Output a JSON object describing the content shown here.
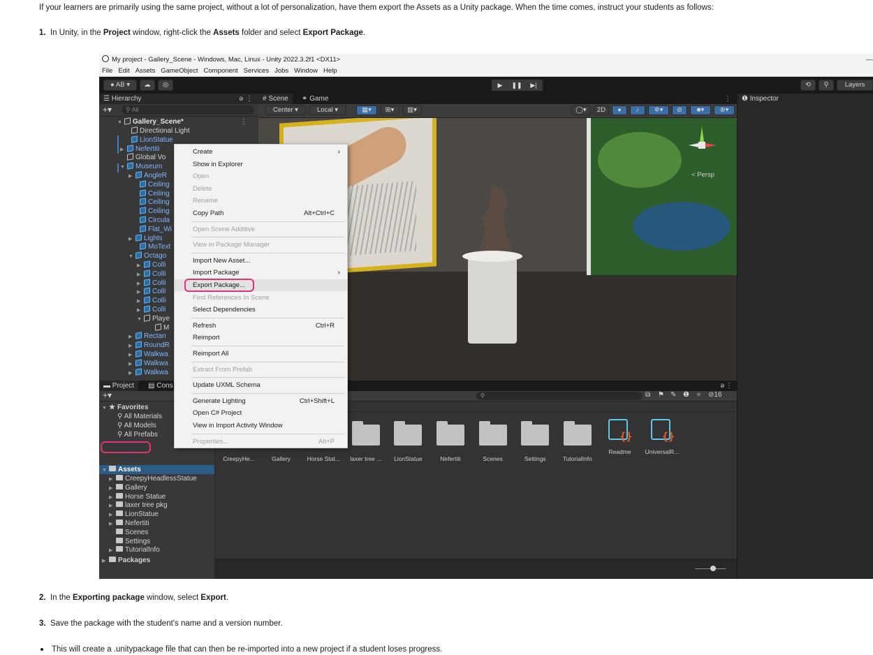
{
  "doc": {
    "intro": "If your learners are primarily using the same project, without a lot of personalization, have them export the Assets as a Unity package. When the time comes, instruct your students as follows:",
    "step1": {
      "num": "1.",
      "p1": "In Unity, in the ",
      "b1": "Project",
      "p2": " window, right-click the ",
      "b2": "Assets",
      "p3": " folder and select ",
      "b3": "Export Package",
      "p4": "."
    },
    "step2": {
      "num": "2.",
      "p1": "In the ",
      "b1": "Exporting package",
      "p2": " window, select ",
      "b2": "Export",
      "p3": "."
    },
    "step3": {
      "num": "3.",
      "text": "Save the package with the student's name and a version number."
    },
    "bullet": "This will create a .unitypackage file that can then be re-imported into a new project if a student loses progress."
  },
  "unity": {
    "title": "My project - Gallery_Scene - Windows, Mac, Linux - Unity 2022.3.2f1 <DX11>",
    "menu": [
      "File",
      "Edit",
      "Assets",
      "GameObject",
      "Component",
      "Services",
      "Jobs",
      "Window",
      "Help"
    ],
    "toolbar": {
      "account": "AB ▾",
      "cloud": "☁",
      "settings": "◎",
      "play": "▶",
      "pause": "❚❚",
      "step": "▶|",
      "history": "⟲",
      "search": "⚲",
      "layers": "Layers"
    },
    "hierarchy": {
      "tab": "☰ Hierarchy",
      "search_placeholder": "All",
      "scene_name": "Gallery_Scene*",
      "items": [
        {
          "label": "Directional Light",
          "blue": false
        },
        {
          "label": "LionStatue",
          "blue": true
        },
        {
          "label": "Nefertiti",
          "blue": true
        },
        {
          "label": "Global Vo",
          "blue": false
        },
        {
          "label": "Museum",
          "blue": true
        },
        {
          "label": "AngleR",
          "blue": true
        },
        {
          "label": "Ceiling",
          "blue": true
        },
        {
          "label": "Ceiling",
          "blue": true
        },
        {
          "label": "Ceiling",
          "blue": true
        },
        {
          "label": "Ceiling",
          "blue": true
        },
        {
          "label": "Circula",
          "blue": true
        },
        {
          "label": "Flat_Wi",
          "blue": true
        },
        {
          "label": "Lights",
          "blue": true
        },
        {
          "label": "MoText",
          "blue": true
        },
        {
          "label": "Octago",
          "blue": true
        },
        {
          "label": "Colli",
          "blue": true
        },
        {
          "label": "Colli",
          "blue": true
        },
        {
          "label": "Colli",
          "blue": true
        },
        {
          "label": "Colli",
          "blue": true
        },
        {
          "label": "Colli",
          "blue": true
        },
        {
          "label": "Colli",
          "blue": true
        },
        {
          "label": "Playe",
          "blue": false
        },
        {
          "label": "M",
          "blue": false
        },
        {
          "label": "Rectan",
          "blue": true
        },
        {
          "label": "RoundR",
          "blue": true
        },
        {
          "label": "Walkwa",
          "blue": true
        },
        {
          "label": "Walkwa",
          "blue": true
        },
        {
          "label": "Walkwa",
          "blue": true
        }
      ]
    },
    "scene": {
      "tab_scene": "# Scene",
      "tab_game": "⚭ Game",
      "pivot": "Center ▾",
      "space": "Local ▾",
      "mode_2d": "2D",
      "persp": "< Persp"
    },
    "inspector": {
      "tab": "❶ Inspector"
    },
    "project": {
      "tab_project": "Project",
      "tab_console": "Cons",
      "hidden_count": "16",
      "favorites": {
        "label": "Favorites",
        "items": [
          "All Materials",
          "All Models",
          "All Prefabs"
        ]
      },
      "assets_label": "Assets",
      "asset_folders": [
        "CreepyHeadlessStatue",
        "Gallery",
        "Horse Statue",
        "laxer tree pkg",
        "LionStatue",
        "Nefertiti",
        "Scenes",
        "Settings",
        "TutorialInfo"
      ],
      "packages_label": "Packages",
      "grid": [
        {
          "label": "CreepyHe...",
          "kind": "folder"
        },
        {
          "label": "Gallery",
          "kind": "folder"
        },
        {
          "label": "Horse Stat...",
          "kind": "folder"
        },
        {
          "label": "laxer tree ...",
          "kind": "folder"
        },
        {
          "label": "LionStatue",
          "kind": "folder"
        },
        {
          "label": "Nefertiti",
          "kind": "folder"
        },
        {
          "label": "Scenes",
          "kind": "folder"
        },
        {
          "label": "Settings",
          "kind": "folder"
        },
        {
          "label": "TutorialInfo",
          "kind": "folder"
        },
        {
          "label": "Readme",
          "kind": "asset"
        },
        {
          "label": "UniversalR...",
          "kind": "asset"
        }
      ]
    },
    "context_menu": [
      {
        "label": "Create",
        "submenu": true
      },
      {
        "label": "Show in Explorer"
      },
      {
        "label": "Open",
        "disabled": true
      },
      {
        "label": "Delete",
        "disabled": true
      },
      {
        "label": "Rename",
        "disabled": true
      },
      {
        "label": "Copy Path",
        "shortcut": "Alt+Ctrl+C"
      },
      {
        "sep": true
      },
      {
        "label": "Open Scene Additive",
        "disabled": true
      },
      {
        "sep": true
      },
      {
        "label": "View in Package Manager",
        "disabled": true
      },
      {
        "sep": true
      },
      {
        "label": "Import New Asset..."
      },
      {
        "label": "Import Package",
        "submenu": true
      },
      {
        "label": "Export Package...",
        "highlight": true
      },
      {
        "label": "Find References In Scene",
        "disabled": true
      },
      {
        "label": "Select Dependencies"
      },
      {
        "sep": true
      },
      {
        "label": "Refresh",
        "shortcut": "Ctrl+R"
      },
      {
        "label": "Reimport"
      },
      {
        "sep": true
      },
      {
        "label": "Reimport All"
      },
      {
        "sep": true
      },
      {
        "label": "Extract From Prefab",
        "disabled": true
      },
      {
        "sep": true
      },
      {
        "label": "Update UXML Schema"
      },
      {
        "sep": true
      },
      {
        "label": "Generate Lighting",
        "shortcut": "Ctrl+Shift+L"
      },
      {
        "label": "Open C# Project"
      },
      {
        "label": "View in Import Activity Window"
      },
      {
        "sep": true
      },
      {
        "label": "Properties...",
        "shortcut": "Alt+P",
        "disabled": true
      }
    ],
    "highlight_color": "#e0317a",
    "selection_color": "#2c5d87",
    "prefab_blue": "#7fb6ff"
  }
}
